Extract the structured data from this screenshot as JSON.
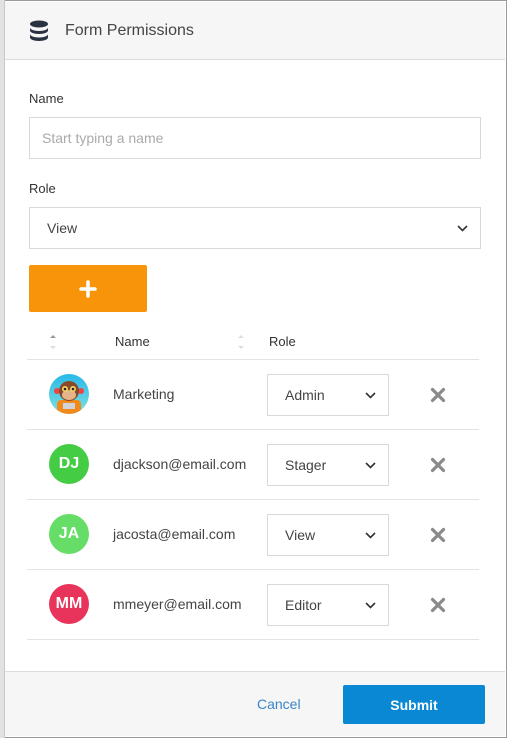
{
  "header": {
    "title": "Form Permissions",
    "icon": "database-icon"
  },
  "form": {
    "name_label": "Name",
    "name_placeholder": "Start typing a name",
    "name_value": "",
    "role_label": "Role",
    "role_value": "View",
    "add_button_icon": "plus-icon"
  },
  "table": {
    "columns": [
      "Name",
      "Role"
    ],
    "rows": [
      {
        "name": "Marketing",
        "initials": "",
        "avatar_type": "image",
        "avatar_color": "#2bb6e0",
        "role": "Admin"
      },
      {
        "name": "djackson@email.com",
        "initials": "DJ",
        "avatar_type": "initials",
        "avatar_color": "#44cc44",
        "role": "Stager"
      },
      {
        "name": "jacosta@email.com",
        "initials": "JA",
        "avatar_type": "initials",
        "avatar_color": "#66dd66",
        "role": "View"
      },
      {
        "name": "mmeyer@email.com",
        "initials": "MM",
        "avatar_type": "initials",
        "avatar_color": "#e8345a",
        "role": "Editor"
      }
    ]
  },
  "footer": {
    "cancel_label": "Cancel",
    "submit_label": "Submit"
  },
  "colors": {
    "accent_orange": "#f7940a",
    "primary_blue": "#0a88d4",
    "link_blue": "#3a86c8"
  }
}
